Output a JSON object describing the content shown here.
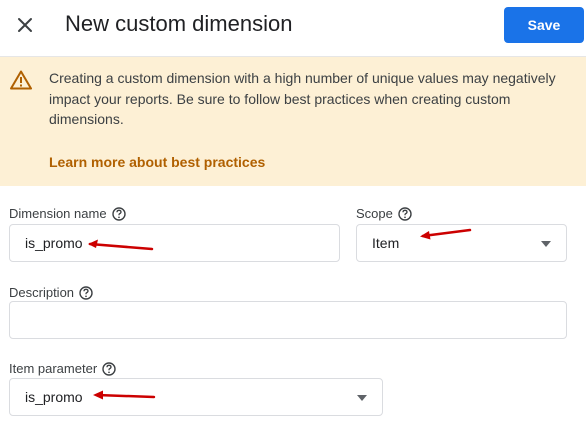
{
  "header": {
    "title": "New custom dimension",
    "save_label": "Save"
  },
  "banner": {
    "message": "Creating a custom dimension with a high number of unique values may negatively impact your reports. Be sure to follow best practices when creating custom dimensions.",
    "link_text": "Learn more about best practices"
  },
  "form": {
    "dimension_name": {
      "label": "Dimension name",
      "value": "is_promo"
    },
    "scope": {
      "label": "Scope",
      "value": "Item"
    },
    "description": {
      "label": "Description",
      "value": ""
    },
    "item_parameter": {
      "label": "Item parameter",
      "value": "is_promo"
    }
  },
  "icons": {
    "close": "close-icon",
    "warning": "warning-icon",
    "help": "help-circle-icon",
    "dropdown": "arrow-drop-down-icon",
    "annotation": "red-arrow-annotation"
  },
  "colors": {
    "primary": "#1a73e8",
    "banner_bg": "#fdf0d5",
    "warning": "#b06000",
    "annotation": "#cc0000"
  }
}
